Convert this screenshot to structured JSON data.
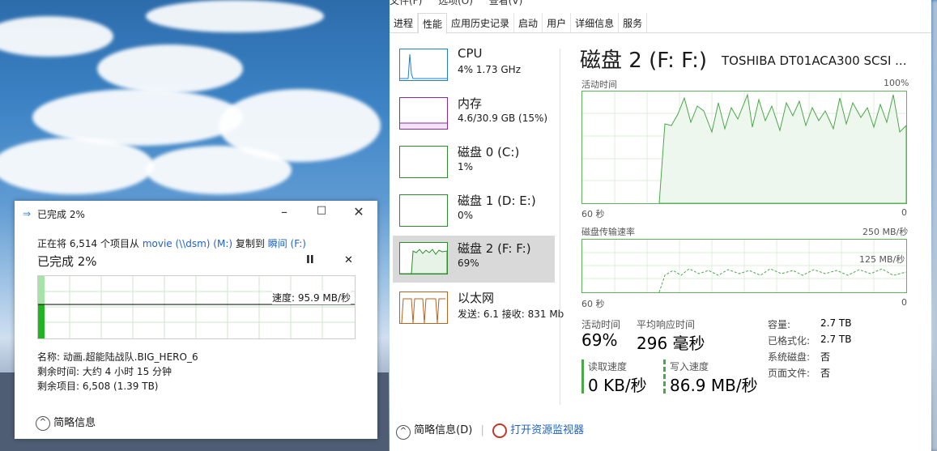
{
  "task_manager": {
    "menu": [
      "文件(F)",
      "选项(O)",
      "查看(V)"
    ],
    "tabs": [
      "进程",
      "性能",
      "应用历史记录",
      "启动",
      "用户",
      "详细信息",
      "服务"
    ],
    "active_tab": "性能",
    "sidebar": [
      {
        "name": "CPU",
        "sub": "4% 1.73 GHz"
      },
      {
        "name": "内存",
        "sub": "4.6/30.9 GB (15%)"
      },
      {
        "name": "磁盘 0 (C:)",
        "sub": "1%"
      },
      {
        "name": "磁盘 1 (D: E:)",
        "sub": "0%"
      },
      {
        "name": "磁盘 2 (F: F:)",
        "sub": "69%"
      },
      {
        "name": "以太网",
        "sub": "发送: 6.1 接收: 831 Mb"
      }
    ],
    "selected": "磁盘 2 (F: F:)",
    "detail": {
      "title": "磁盘 2 (F: F:)",
      "model": "TOSHIBA DT01ACA300 SCSI ...",
      "graph1": {
        "label": "活动时间",
        "max": "100%",
        "x_left": "60 秒",
        "x_right": "0"
      },
      "graph2": {
        "label": "磁盘传输速率",
        "max": "250 MB/秒",
        "mid": "125 MB/秒",
        "x_left": "60 秒",
        "x_right": "0"
      },
      "activity_label": "活动时间",
      "activity_value": "69%",
      "response_label": "平均响应时间",
      "response_value": "296 毫秒",
      "read_label": "读取速度",
      "read_value": "0 KB/秒",
      "write_label": "写入速度",
      "write_value": "86.9 MB/秒",
      "capacity_k": "容量:",
      "capacity_v": "2.7 TB",
      "formatted_k": "已格式化:",
      "formatted_v": "2.7 TB",
      "system_k": "系统磁盘:",
      "system_v": "否",
      "pagefile_k": "页面文件:",
      "pagefile_v": "否"
    },
    "footer": {
      "less": "简略信息(D)",
      "monitor": "打开资源监视器"
    }
  },
  "copy_dialog": {
    "title": "已完成 2%",
    "line_prefix": "正在将 6,514 个项目从",
    "source": "movie (\\\\dsm) (M:)",
    "copy_to": "复制到",
    "dest": "瞬间 (F:)",
    "status": "已完成 2%",
    "speed": "速度: 95.9 MB/秒",
    "name": "名称: 动画.超能陆战队.BIG_HERO_6",
    "time_left": "剩余时间: 大约 4 小时 15 分钟",
    "items_left": "剩余项目: 6,508 (1.39 TB)",
    "less": "简略信息",
    "progress": 0.02
  }
}
